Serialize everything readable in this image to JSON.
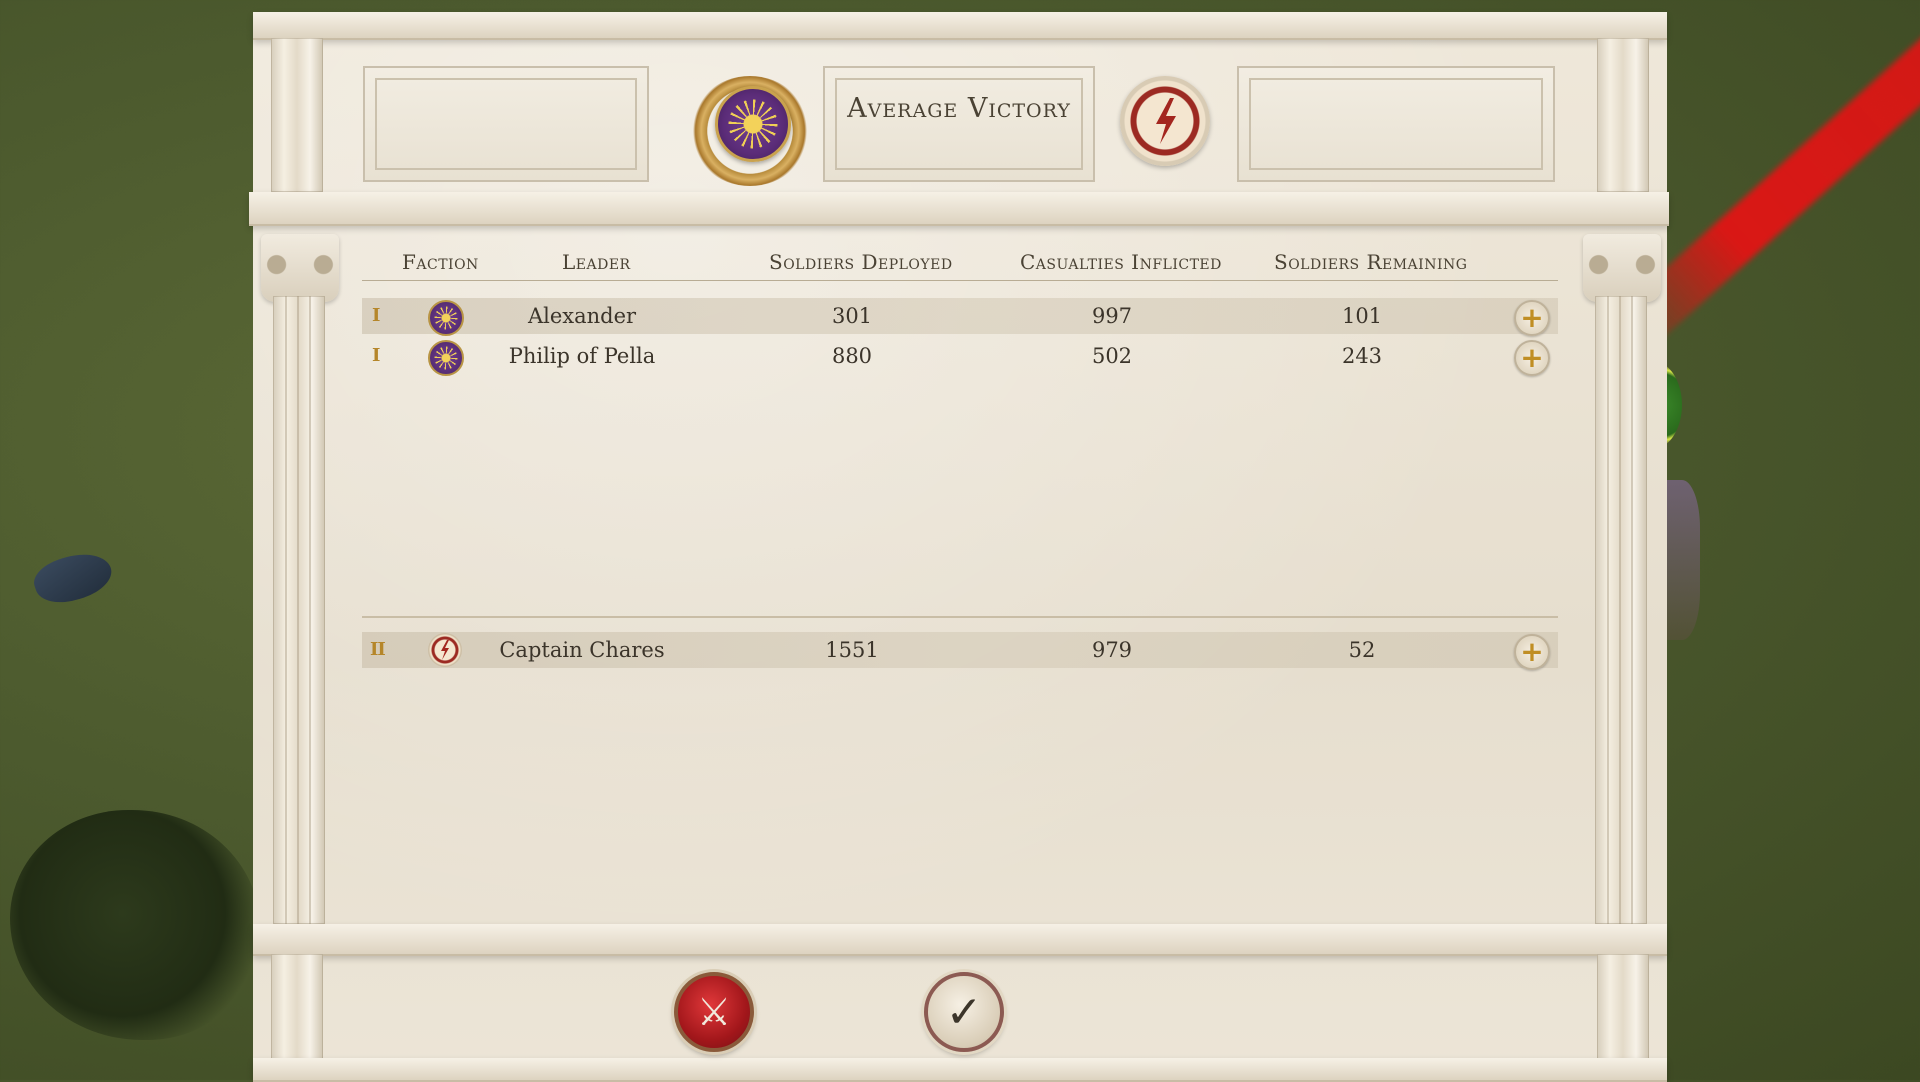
{
  "result": {
    "title": "Average Victory"
  },
  "factions": {
    "player_emblem": "sun-emblem",
    "enemy_emblem": "lightning-bolt-emblem"
  },
  "table": {
    "headers": {
      "faction": "Faction",
      "leader": "Leader",
      "deployed": "Soldiers Deployed",
      "casualties": "Casualties Inflicted",
      "remaining": "Soldiers Remaining"
    },
    "allies": [
      {
        "rank": "I",
        "faction_icon": "sun-emblem",
        "leader": "Alexander",
        "deployed": "301",
        "casualties": "997",
        "remaining": "101",
        "shaded": true
      },
      {
        "rank": "I",
        "faction_icon": "sun-emblem",
        "leader": "Philip of Pella",
        "deployed": "880",
        "casualties": "502",
        "remaining": "243",
        "shaded": false
      }
    ],
    "enemies": [
      {
        "rank": "II",
        "faction_icon": "lightning-bolt-emblem",
        "leader": "Captain Chares",
        "deployed": "1551",
        "casualties": "979",
        "remaining": "52",
        "shaded": true
      }
    ]
  },
  "buttons": {
    "cancel_icon": "crossed-swords-icon",
    "confirm_icon": "checkmark-icon",
    "cancel_glyph": "⚔",
    "confirm_glyph": "✓",
    "expand_glyph": "+"
  },
  "colors": {
    "accent_gold": "#c08e24",
    "player_purple": "#5b2c78",
    "enemy_red": "#9c2a22",
    "cancel_red": "#a3171b"
  }
}
